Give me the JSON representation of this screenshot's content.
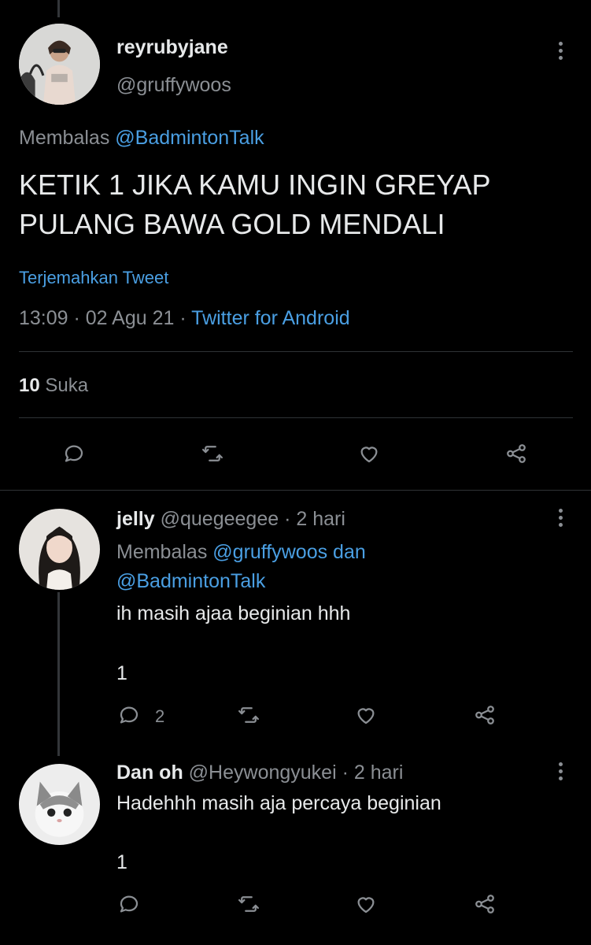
{
  "main_tweet": {
    "display_name": "reyrubyjane",
    "handle": "@gruffywoos",
    "reply_prefix": "Membalas",
    "reply_to": "@BadmintonTalk",
    "text_line1": "KETIK 1 JIKA KAMU INGIN GREYAP",
    "text_line2": "PULANG BAWA GOLD MENDALI",
    "translate_label": "Terjemahkan Tweet",
    "timestamp": "13:09 · 02 Agu 21 ·",
    "source": "Twitter for Android",
    "likes_count": "10",
    "likes_label": "Suka"
  },
  "replies": [
    {
      "display_name": "jelly",
      "meta": "@quegeegee · 2 hari",
      "reply_prefix": "Membalas",
      "reply_to_1": "@gruffywoos dan",
      "reply_to_2": "@BadmintonTalk",
      "text": "ih masih ajaa beginian hhh",
      "text2": "1",
      "reply_count": "2"
    },
    {
      "display_name": "Dan oh",
      "meta": "@Heywongyukei · 2 hari",
      "text": "Hadehhh masih aja percaya beginian",
      "text2": "1"
    }
  ],
  "colors": {
    "background": "#000000",
    "text": "#e7e9ea",
    "muted": "#8b8f94",
    "link": "#4a9fe3",
    "divider": "#2f3336"
  },
  "icons": [
    "more-vertical-icon",
    "reply-icon",
    "retweet-icon",
    "like-icon",
    "share-icon"
  ]
}
